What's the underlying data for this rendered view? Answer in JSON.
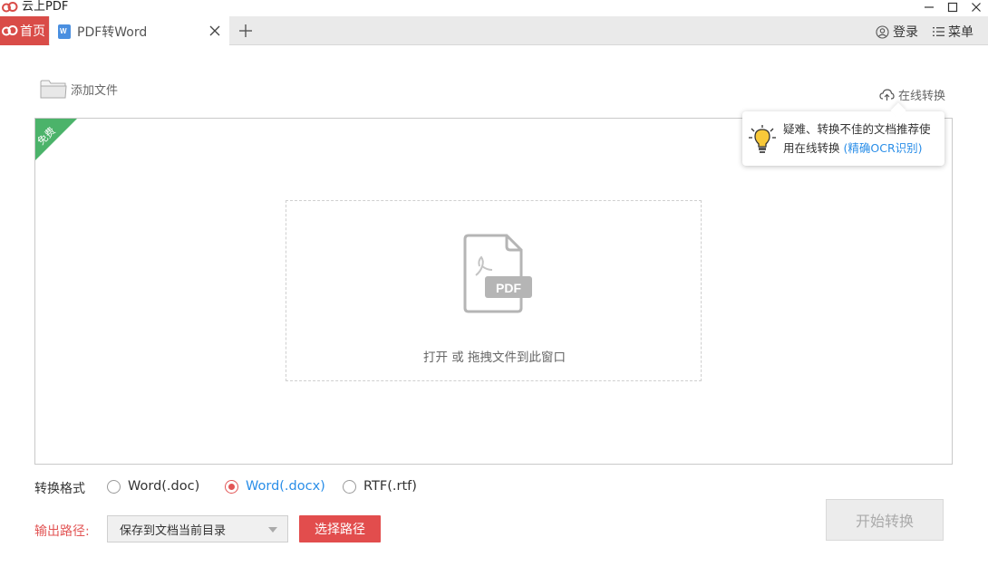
{
  "app": {
    "title": "云上PDF"
  },
  "tabs": {
    "home_label": "首页",
    "active_label": "PDF转Word"
  },
  "header": {
    "login_label": "登录",
    "menu_label": "菜单"
  },
  "toolbar": {
    "add_file_label": "添加文件",
    "online_convert_label": "在线转换"
  },
  "tooltip": {
    "line1": "疑难、转换不佳的文档推荐使",
    "line2": "用在线转换",
    "link": "(精确OCR识别)"
  },
  "panel": {
    "ribbon_label": "免费",
    "pdf_icon_label": "PDF",
    "drop_hint": "打开 或 拖拽文件到此窗口"
  },
  "format": {
    "label": "转换格式",
    "options": [
      "Word(.doc)",
      "Word(.docx)",
      "RTF(.rtf)"
    ],
    "selected": "Word(.docx)"
  },
  "output": {
    "label": "输出路径:",
    "path_value": "保存到文档当前目录",
    "choose_label": "选择路径"
  },
  "start_label": "开始转换",
  "colors": {
    "accent_red": "#e24d4d",
    "link_blue": "#2a8ee8",
    "ribbon_green": "#4bb36a"
  }
}
